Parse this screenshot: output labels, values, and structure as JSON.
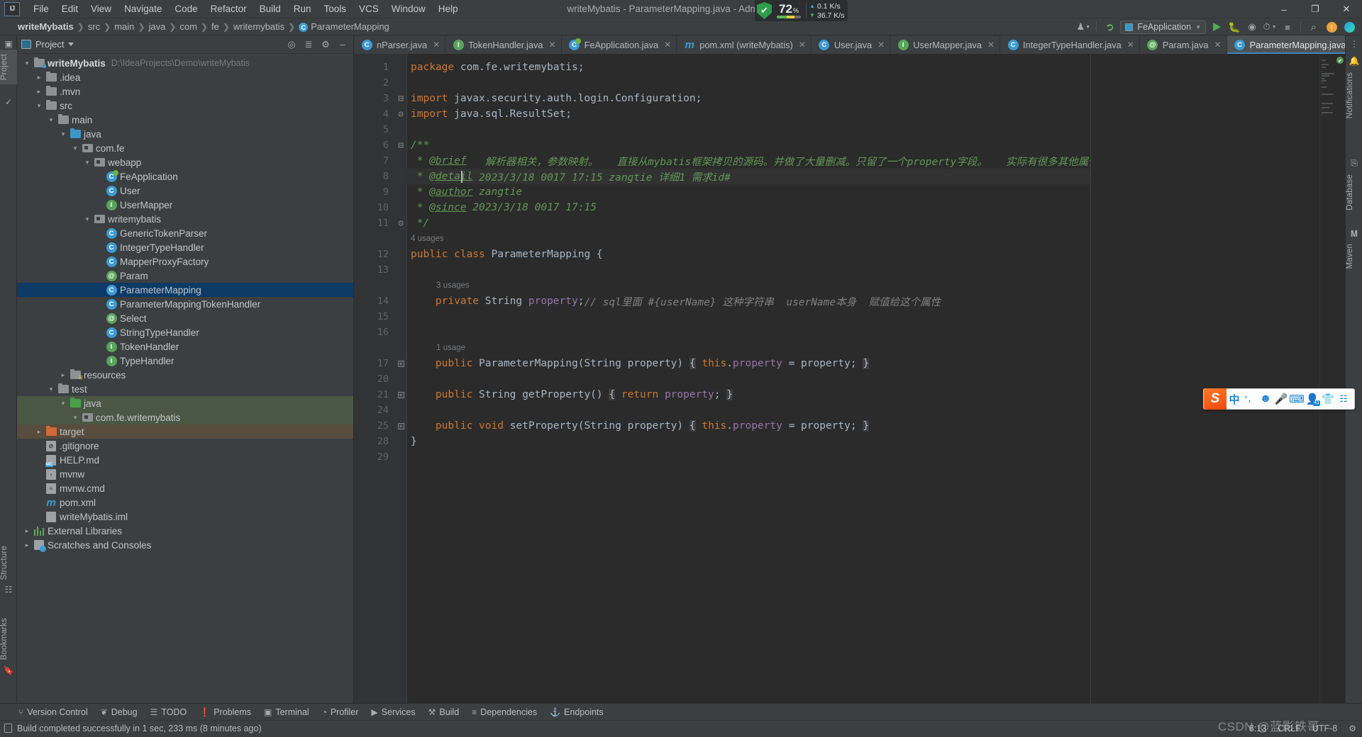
{
  "window": {
    "title": "writeMybatis - ParameterMapping.java - Administrator",
    "minimize": "–",
    "maximize": "❐",
    "close": "✕"
  },
  "menu": [
    {
      "label": "File"
    },
    {
      "label": "Edit"
    },
    {
      "label": "View"
    },
    {
      "label": "Navigate"
    },
    {
      "label": "Code"
    },
    {
      "label": "Refactor"
    },
    {
      "label": "Build"
    },
    {
      "label": "Run"
    },
    {
      "label": "Tools"
    },
    {
      "label": "VCS"
    },
    {
      "label": "Window"
    },
    {
      "label": "Help"
    }
  ],
  "net_widget": {
    "cpu_percent": "72",
    "cpu_unit": "%",
    "upload": "0.1 K/s",
    "download": "36.7 K/s",
    "shield_glyph": "✔",
    "colors": {
      "shield": "#2e9e4a",
      "bar_green": "#57b85a",
      "bar_yellow": "#e8c93d",
      "bar_orange": "#e8a33d"
    }
  },
  "breadcrumb": {
    "items": [
      "writeMybatis",
      "src",
      "main",
      "java",
      "com",
      "fe",
      "writemybatis"
    ],
    "separator": "❯",
    "current": "ParameterMapping",
    "current_badge": "C"
  },
  "toolbar": {
    "user_icon": "♟",
    "build_hammer": "build-hammer",
    "run_config": "FeApplication",
    "run": "run-button",
    "debug": "debug-button",
    "run_coverage": "run-with-coverage-button",
    "profiler": "profiler-button",
    "stop": "stop-button",
    "search": "⌕",
    "update": "↑",
    "notifications": "blue-play-icon"
  },
  "project_panel": {
    "title": "Project",
    "locate_icon": "⌖",
    "collapse_icon": "≡",
    "root": {
      "name": "writeMybatis",
      "path": "D:\\IdeaProjects\\Demo\\writeMybatis"
    },
    "tree": [
      {
        "indent": 0,
        "twisty": "down",
        "icon": "folder-module",
        "label": "writeMybatis",
        "bold": true,
        "path": "D:\\IdeaProjects\\Demo\\writeMybatis"
      },
      {
        "indent": 1,
        "twisty": "right",
        "icon": "folder",
        "label": ".idea"
      },
      {
        "indent": 1,
        "twisty": "right",
        "icon": "folder",
        "label": ".mvn"
      },
      {
        "indent": 1,
        "twisty": "down",
        "icon": "folder",
        "label": "src"
      },
      {
        "indent": 2,
        "twisty": "down",
        "icon": "folder",
        "label": "main"
      },
      {
        "indent": 3,
        "twisty": "down",
        "icon": "folder-source",
        "label": "java"
      },
      {
        "indent": 4,
        "twisty": "down",
        "icon": "package",
        "label": "com.fe"
      },
      {
        "indent": 5,
        "twisty": "down",
        "icon": "package",
        "label": "webapp"
      },
      {
        "indent": 6,
        "twisty": "none",
        "icon": "class-spring",
        "label": "FeApplication"
      },
      {
        "indent": 6,
        "twisty": "none",
        "icon": "class",
        "label": "User"
      },
      {
        "indent": 6,
        "twisty": "none",
        "icon": "interface",
        "label": "UserMapper"
      },
      {
        "indent": 5,
        "twisty": "down",
        "icon": "package",
        "label": "writemybatis"
      },
      {
        "indent": 6,
        "twisty": "none",
        "icon": "class",
        "label": "GenericTokenParser"
      },
      {
        "indent": 6,
        "twisty": "none",
        "icon": "class",
        "label": "IntegerTypeHandler"
      },
      {
        "indent": 6,
        "twisty": "none",
        "icon": "class",
        "label": "MapperProxyFactory"
      },
      {
        "indent": 6,
        "twisty": "none",
        "icon": "annotation",
        "label": "Param"
      },
      {
        "indent": 6,
        "twisty": "none",
        "icon": "class",
        "label": "ParameterMapping",
        "selected": true
      },
      {
        "indent": 6,
        "twisty": "none",
        "icon": "class",
        "label": "ParameterMappingTokenHandler"
      },
      {
        "indent": 6,
        "twisty": "none",
        "icon": "annotation",
        "label": "Select"
      },
      {
        "indent": 6,
        "twisty": "none",
        "icon": "class",
        "label": "StringTypeHandler"
      },
      {
        "indent": 6,
        "twisty": "none",
        "icon": "interface",
        "label": "TokenHandler"
      },
      {
        "indent": 6,
        "twisty": "none",
        "icon": "interface",
        "label": "TypeHandler"
      },
      {
        "indent": 3,
        "twisty": "right",
        "icon": "folder-resources",
        "label": "resources"
      },
      {
        "indent": 2,
        "twisty": "down",
        "icon": "folder",
        "label": "test"
      },
      {
        "indent": 3,
        "twisty": "down",
        "icon": "folder-test",
        "label": "java",
        "highlight": "green"
      },
      {
        "indent": 4,
        "twisty": "down",
        "icon": "package",
        "label": "com.fe.writemybatis",
        "highlight": "green"
      },
      {
        "indent": 1,
        "twisty": "right",
        "icon": "folder-target",
        "label": "target",
        "highlight": "brown"
      },
      {
        "indent": 1,
        "twisty": "none",
        "icon": "file-git",
        "label": ".gitignore"
      },
      {
        "indent": 1,
        "twisty": "none",
        "icon": "file-md",
        "label": "HELP.md"
      },
      {
        "indent": 1,
        "twisty": "none",
        "icon": "file-sh",
        "label": "mvnw"
      },
      {
        "indent": 1,
        "twisty": "none",
        "icon": "file-cmd",
        "label": "mvnw.cmd"
      },
      {
        "indent": 1,
        "twisty": "none",
        "icon": "file-maven",
        "label": "pom.xml"
      },
      {
        "indent": 1,
        "twisty": "none",
        "icon": "file-iml",
        "label": "writeMybatis.iml"
      },
      {
        "indent": 0,
        "twisty": "right",
        "icon": "libraries",
        "label": "External Libraries"
      },
      {
        "indent": 0,
        "twisty": "right",
        "icon": "scratches",
        "label": "Scratches and Consoles"
      }
    ]
  },
  "left_stripe": {
    "project_tab": "Project",
    "structure_tab": "Structure",
    "bookmarks_tab": "Bookmarks"
  },
  "right_stripe": {
    "notifications_tab": "Notifications",
    "database_tab": "Database",
    "maven_tab": "Maven",
    "more_icon": "⋮"
  },
  "editor_tabs": [
    {
      "label": "nParser.java",
      "icon": "class",
      "truncated": true
    },
    {
      "label": "TokenHandler.java",
      "icon": "interface"
    },
    {
      "label": "FeApplication.java",
      "icon": "class-spring"
    },
    {
      "label": "pom.xml (writeMybatis)",
      "icon": "maven"
    },
    {
      "label": "User.java",
      "icon": "class"
    },
    {
      "label": "UserMapper.java",
      "icon": "interface"
    },
    {
      "label": "IntegerTypeHandler.java",
      "icon": "class"
    },
    {
      "label": "Param.java",
      "icon": "annotation"
    },
    {
      "label": "ParameterMapping.java",
      "icon": "class",
      "active": true
    }
  ],
  "editor_tab_actions": {
    "chevron": "⌄",
    "more": "⋮"
  },
  "code": {
    "inspection_status": "✔",
    "lines": [
      {
        "num": "1",
        "tokens": [
          {
            "t": "package ",
            "c": "kw"
          },
          {
            "t": "com.fe.writemybatis",
            "c": "pun"
          },
          {
            "t": ";",
            "c": "pun"
          }
        ]
      },
      {
        "num": "2",
        "tokens": []
      },
      {
        "num": "3",
        "fold": "start",
        "tokens": [
          {
            "t": "import ",
            "c": "kw"
          },
          {
            "t": "javax.security.auth.login.Configuration",
            "c": "pun"
          },
          {
            "t": ";",
            "c": "pun"
          }
        ]
      },
      {
        "num": "4",
        "fold": "end",
        "tokens": [
          {
            "t": "import ",
            "c": "kw"
          },
          {
            "t": "java.sql.ResultSet",
            "c": "pun"
          },
          {
            "t": ";",
            "c": "pun"
          }
        ]
      },
      {
        "num": "5",
        "tokens": []
      },
      {
        "num": "6",
        "fold": "start",
        "tokens": [
          {
            "t": "/**",
            "c": "cmt"
          }
        ]
      },
      {
        "num": "7",
        "tokens": [
          {
            "t": " * ",
            "c": "cmt"
          },
          {
            "t": "@brief",
            "c": "doctag"
          },
          {
            "t": "   解析器相关，参数映射。   直接从mybatis框架拷贝的源码。并做了大量删减。只留了一个property字段。   实际有很多其他属性字段",
            "c": "cmt"
          }
        ]
      },
      {
        "num": "8",
        "highlight": true,
        "caret_after": 7,
        "tokens": [
          {
            "t": " * ",
            "c": "cmt"
          },
          {
            "t": "@detail",
            "c": "doctag"
          },
          {
            "t": " 2023/3/18 0017 17:15 zangtie 详细1 需求id#",
            "c": "cmt"
          }
        ]
      },
      {
        "num": "9",
        "tokens": [
          {
            "t": " * ",
            "c": "cmt"
          },
          {
            "t": "@author",
            "c": "doctag"
          },
          {
            "t": " zangtie",
            "c": "cmt"
          }
        ]
      },
      {
        "num": "10",
        "tokens": [
          {
            "t": " * ",
            "c": "cmt"
          },
          {
            "t": "@since",
            "c": "doctag"
          },
          {
            "t": " 2023/3/18 0017 17:15",
            "c": "cmt"
          }
        ]
      },
      {
        "num": "11",
        "fold": "end",
        "tokens": [
          {
            "t": " */",
            "c": "cmt"
          }
        ]
      },
      {
        "num": "",
        "usage": "4 usages"
      },
      {
        "num": "12",
        "tokens": [
          {
            "t": "public ",
            "c": "kw"
          },
          {
            "t": "class ",
            "c": "kw"
          },
          {
            "t": "ParameterMapping",
            "c": "cls"
          },
          {
            "t": " {",
            "c": "pun"
          }
        ]
      },
      {
        "num": "13",
        "tokens": []
      },
      {
        "num": "",
        "usage": "3 usages",
        "indent_usage": true
      },
      {
        "num": "14",
        "tokens": [
          {
            "t": "    ",
            "c": "pun"
          },
          {
            "t": "private ",
            "c": "kw"
          },
          {
            "t": "String ",
            "c": "cls"
          },
          {
            "t": "property",
            "c": "fld"
          },
          {
            "t": ";",
            "c": "pun"
          },
          {
            "t": "// sql里面 #{userName} 这种字符串  userName本身  赋值给这个属性",
            "c": "cmt2"
          }
        ]
      },
      {
        "num": "15",
        "tokens": []
      },
      {
        "num": "16",
        "tokens": []
      },
      {
        "num": "",
        "usage": "1 usage",
        "indent_usage": true
      },
      {
        "num": "17",
        "foldbox": true,
        "tokens": [
          {
            "t": "    ",
            "c": "pun"
          },
          {
            "t": "public ",
            "c": "kw"
          },
          {
            "t": "ParameterMapping",
            "c": "cls"
          },
          {
            "t": "(",
            "c": "pun"
          },
          {
            "t": "String ",
            "c": "cls"
          },
          {
            "t": "property",
            "c": "pun"
          },
          {
            "t": ") ",
            "c": "pun"
          },
          {
            "t": "{",
            "c": "brace"
          },
          {
            "t": " ",
            "c": "pun"
          },
          {
            "t": "this",
            "c": "kw"
          },
          {
            "t": ".",
            "c": "pun"
          },
          {
            "t": "property",
            "c": "fld"
          },
          {
            "t": " = property; ",
            "c": "pun"
          },
          {
            "t": "}",
            "c": "brace"
          }
        ]
      },
      {
        "num": "20",
        "tokens": []
      },
      {
        "num": "21",
        "foldbox": true,
        "tokens": [
          {
            "t": "    ",
            "c": "pun"
          },
          {
            "t": "public ",
            "c": "kw"
          },
          {
            "t": "String ",
            "c": "cls"
          },
          {
            "t": "getProperty",
            "c": "cls"
          },
          {
            "t": "() ",
            "c": "pun"
          },
          {
            "t": "{",
            "c": "brace"
          },
          {
            "t": " ",
            "c": "pun"
          },
          {
            "t": "return ",
            "c": "kw"
          },
          {
            "t": "property",
            "c": "fld"
          },
          {
            "t": "; ",
            "c": "pun"
          },
          {
            "t": "}",
            "c": "brace"
          }
        ]
      },
      {
        "num": "24",
        "tokens": []
      },
      {
        "num": "25",
        "foldbox": true,
        "tokens": [
          {
            "t": "    ",
            "c": "pun"
          },
          {
            "t": "public ",
            "c": "kw"
          },
          {
            "t": "void ",
            "c": "kw"
          },
          {
            "t": "setProperty",
            "c": "cls"
          },
          {
            "t": "(",
            "c": "pun"
          },
          {
            "t": "String ",
            "c": "cls"
          },
          {
            "t": "property",
            "c": "pun"
          },
          {
            "t": ") ",
            "c": "pun"
          },
          {
            "t": "{",
            "c": "brace"
          },
          {
            "t": " ",
            "c": "pun"
          },
          {
            "t": "this",
            "c": "kw"
          },
          {
            "t": ".",
            "c": "pun"
          },
          {
            "t": "property",
            "c": "fld"
          },
          {
            "t": " = property; ",
            "c": "pun"
          },
          {
            "t": "}",
            "c": "brace"
          }
        ]
      },
      {
        "num": "28",
        "tokens": [
          {
            "t": "}",
            "c": "pun"
          }
        ]
      },
      {
        "num": "29",
        "tokens": []
      }
    ]
  },
  "bottom_tools": [
    {
      "label": "Version Control",
      "icon": "⑂"
    },
    {
      "label": "Debug",
      "icon": "❦"
    },
    {
      "label": "TODO",
      "icon": "☰"
    },
    {
      "label": "Problems",
      "icon": "❗"
    },
    {
      "label": "Terminal",
      "icon": "▣"
    },
    {
      "label": "Profiler",
      "icon": "◔"
    },
    {
      "label": "Services",
      "icon": "▶"
    },
    {
      "label": "Build",
      "icon": "⚒"
    },
    {
      "label": "Dependencies",
      "icon": "≡"
    },
    {
      "label": "Endpoints",
      "icon": "⚓"
    }
  ],
  "status_bar": {
    "message": "Build completed successfully in 1 sec, 233 ms (8 minutes ago)",
    "caret_position": "8:13",
    "line_separator": "CRLF",
    "encoding": "UTF-8",
    "gear": "⚙"
  },
  "watermark": {
    "text": "CSDN @蓝影铁哥"
  },
  "ime": {
    "logo": "S",
    "lang": "中",
    "punct": "°，",
    "emoji": "☺",
    "mic": "⬤",
    "keyboard": "⌨",
    "user_badge": "41",
    "skin": "▼",
    "apps": "⬛"
  }
}
